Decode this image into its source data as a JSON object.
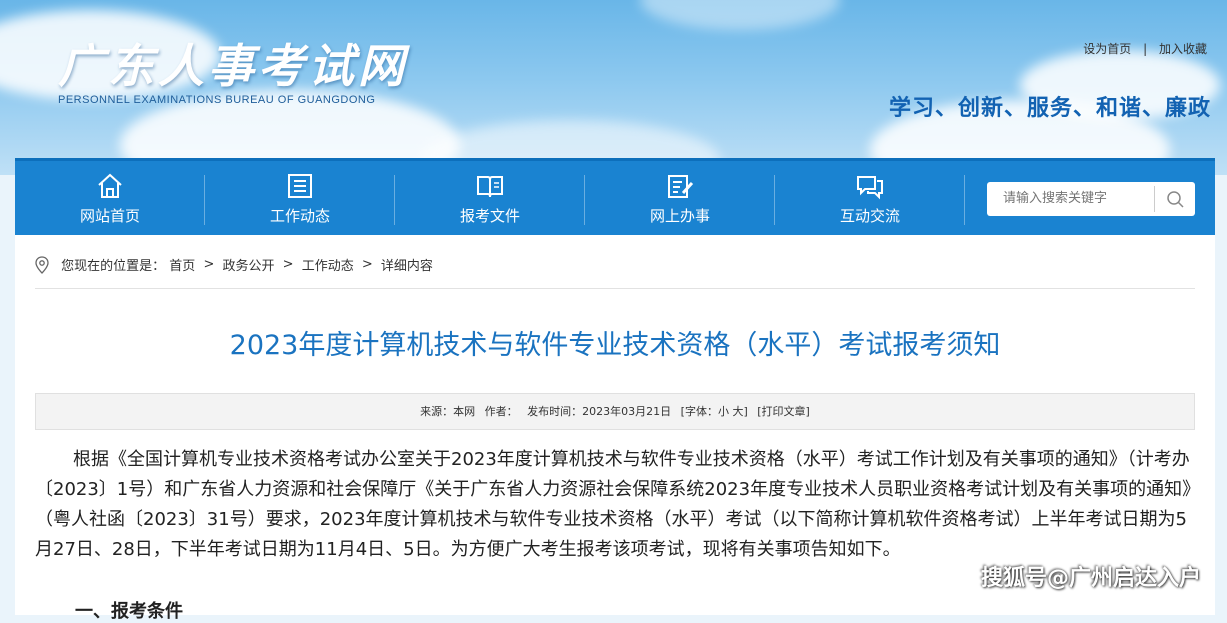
{
  "site": {
    "logo_cn": "广东人事考试网",
    "logo_en": "PERSONNEL EXAMINATIONS BUREAU OF GUANGDONG",
    "slogan": "学习、创新、服务、和谐、廉政",
    "top_links": [
      "设为首页",
      "加入收藏"
    ],
    "top_links_sep": "|"
  },
  "nav": {
    "items": [
      {
        "label": "网站首页",
        "icon": "home-icon"
      },
      {
        "label": "工作动态",
        "icon": "news-icon"
      },
      {
        "label": "报考文件",
        "icon": "book-icon"
      },
      {
        "label": "网上办事",
        "icon": "edit-doc-icon"
      },
      {
        "label": "互动交流",
        "icon": "chat-icon"
      }
    ],
    "search_placeholder": "请输入搜索关键字"
  },
  "breadcrumb": {
    "prefix": "您现在的位置是：",
    "items": [
      "首页",
      "政务公开",
      "工作动态",
      "详细内容"
    ],
    "sep": ">"
  },
  "article": {
    "title": "2023年度计算机技术与软件专业技术资格（水平）考试报考须知",
    "meta": {
      "source": "来源：本网",
      "author": "作者：",
      "date": "发布时间：2023年03月21日",
      "font": "[字体：小 大]",
      "print": "[打印文章]"
    },
    "paragraph": "根据《全国计算机专业技术资格考试办公室关于2023年度计算机技术与软件专业技术资格（水平）考试工作计划及有关事项的通知》（计考办〔2023〕1号）和广东省人力资源和社会保障厅《关于广东省人力资源社会保障系统2023年度专业技术人员职业资格考试计划及有关事项的通知》（粤人社函〔2023〕31号）要求，2023年度计算机技术与软件专业技术资格（水平）考试（以下简称计算机软件资格考试）上半年考试日期为5月27日、28日，下半年考试日期为11月4日、5日。为方便广大考生报考该项考试，现将有关事项告知如下。",
    "next_heading": "一、报考条件"
  },
  "watermark": "搜狐号@广州启达入户",
  "colors": {
    "nav_bg": "#1a83d1",
    "title": "#1a73c0",
    "slogan": "#1262b2"
  }
}
